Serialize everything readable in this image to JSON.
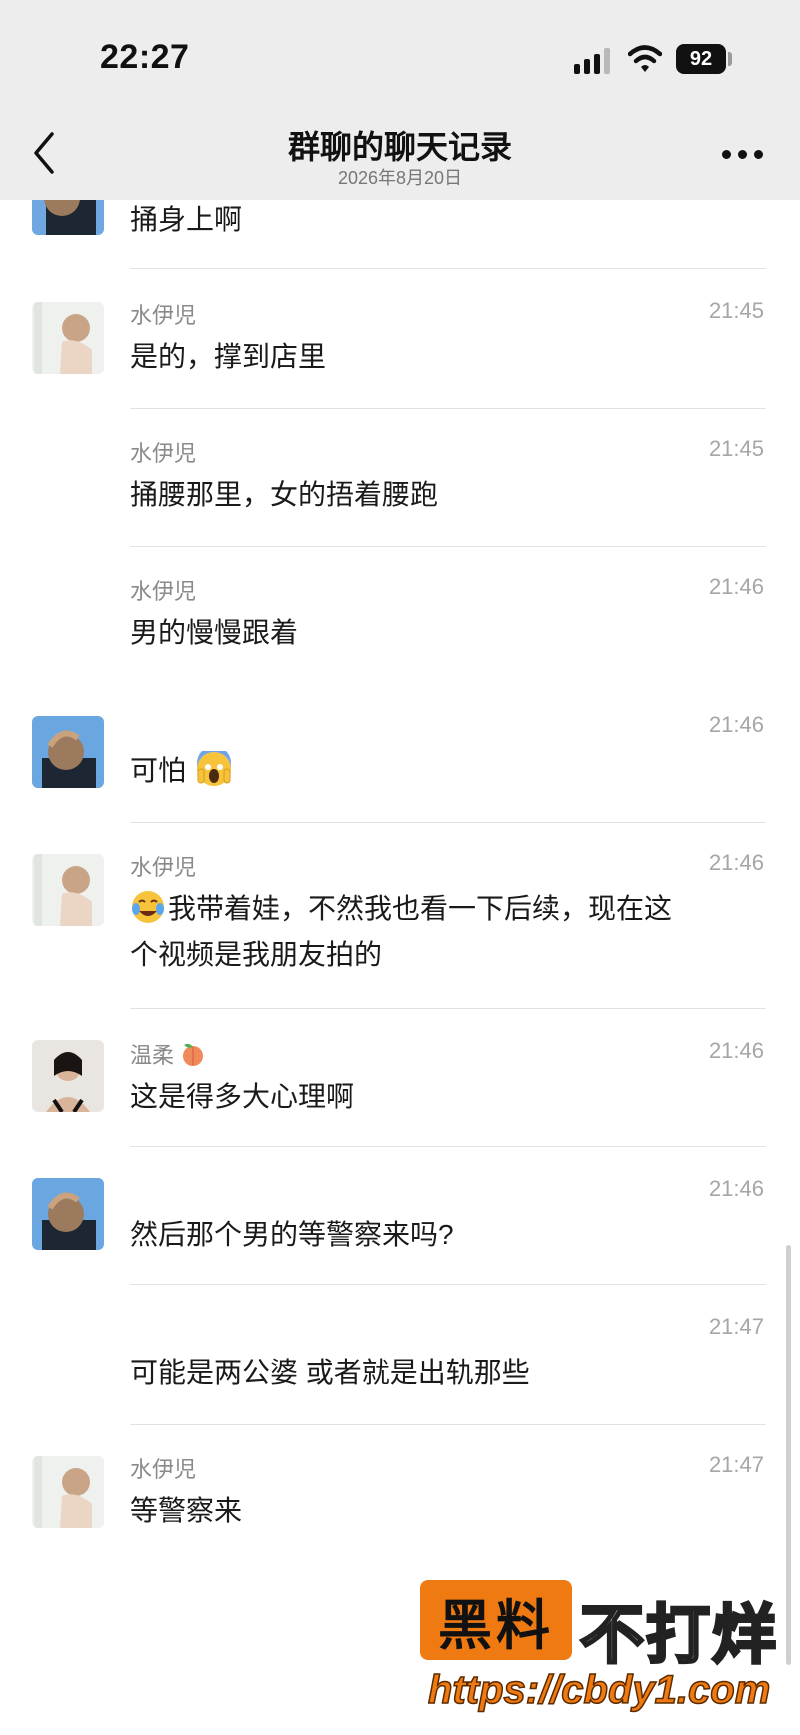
{
  "status_bar": {
    "time": "22:27",
    "battery": "92"
  },
  "nav": {
    "title": "群聊的聊天记录",
    "subtitle": "2026年8月20日"
  },
  "messages": [
    {
      "sender": "",
      "time": "",
      "text": "捅身上啊"
    },
    {
      "sender": "水伊児",
      "time": "21:45",
      "text": "是的，撑到店里"
    },
    {
      "sender": "水伊児",
      "time": "21:45",
      "text": "捅腰那里，女的捂着腰跑"
    },
    {
      "sender": "水伊児",
      "time": "21:46",
      "text": "男的慢慢跟着"
    },
    {
      "sender": "",
      "time": "21:46",
      "text": "可怕"
    },
    {
      "sender": "水伊児",
      "time": "21:46",
      "text_line1": "我带着娃，不然我也看一下后续，现在这",
      "text_line2": "个视频是我朋友拍的"
    },
    {
      "sender": "温柔",
      "time": "21:46",
      "text": "这是得多大心理啊"
    },
    {
      "sender": "",
      "time": "21:46",
      "text": "然后那个男的等警察来吗?"
    },
    {
      "sender": "",
      "time": "21:47",
      "text": "可能是两公婆 或者就是出轨那些"
    },
    {
      "sender": "水伊児",
      "time": "21:47",
      "text": "等警察来"
    }
  ],
  "watermark": {
    "box": "黑料",
    "text": "不打烊",
    "url": "https://cbdy1.com"
  },
  "icons": {
    "back": "chevron-left-icon",
    "more": "more-dots-icon",
    "fear_emoji": "screaming-face-emoji",
    "laugh_emoji": "tears-of-joy-emoji",
    "peach_emoji": "peach-emoji"
  },
  "colors": {
    "topbar": "#ededed",
    "watermark_orange": "#f07a12"
  }
}
